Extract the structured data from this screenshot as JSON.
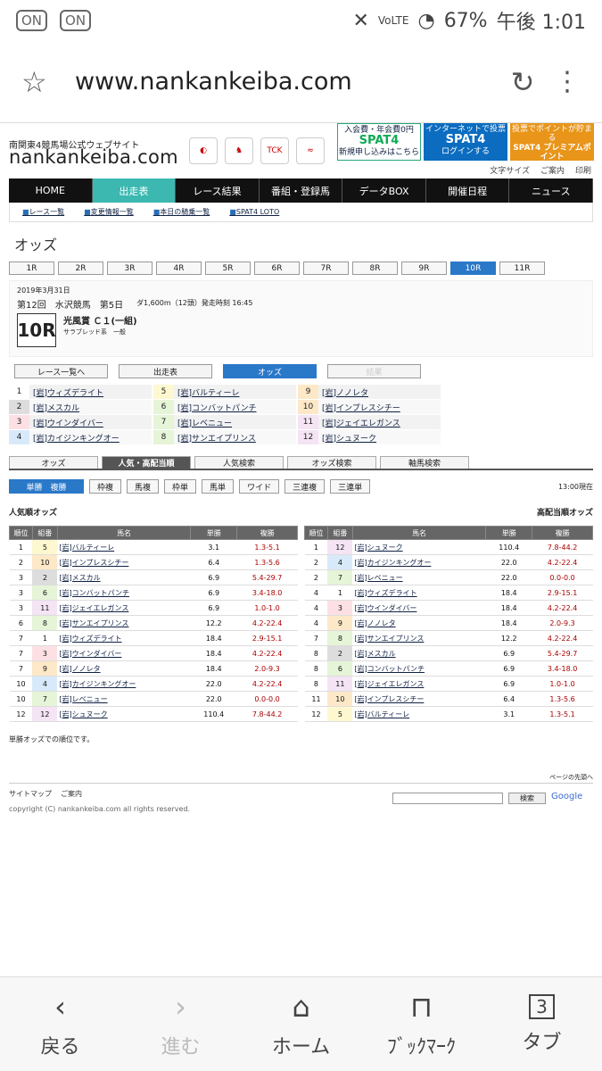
{
  "status": {
    "left_icons": [
      "ON",
      "ON"
    ],
    "volte": "VoLTE",
    "battery": "67%",
    "time": "午後 1:01"
  },
  "browser": {
    "url": "www.nankankeiba.com"
  },
  "site": {
    "subtitle": "南関東4競馬場公式ウェブサイト",
    "logo": "nankankeiba.com",
    "banners": [
      {
        "top": "入会費・年会費0円",
        "main": "SPAT4",
        "bottom": "新規申し込みはこちら"
      },
      {
        "top": "インターネットで投票",
        "main": "SPAT4",
        "bottom": "ログインする"
      },
      {
        "top": "投票でポイントが貯まる",
        "main": "SPAT4 プレミアムポイント",
        "bottom": "ログインする"
      }
    ],
    "tools": [
      "文字サイズ",
      "ご案内",
      "印刷"
    ],
    "nav": [
      "HOME",
      "出走表",
      "レース結果",
      "番組・登録馬",
      "データBOX",
      "開催日程",
      "ニュース"
    ],
    "subnav": [
      "レース一覧",
      "変更情報一覧",
      "本日の騎乗一覧",
      "SPAT4 LOTO"
    ]
  },
  "page_title": "オッズ",
  "races": [
    "1R",
    "2R",
    "3R",
    "4R",
    "5R",
    "6R",
    "7R",
    "8R",
    "9R",
    "10R",
    "11R"
  ],
  "race_info": {
    "date": "2019年3月31日",
    "meet": "第12回　水沢競馬　第5日",
    "distance": "ダ1,600m（12頭）発走時刻 16:45",
    "number": "10R",
    "name": "光風賞 Ｃ１(一組)",
    "class": "サラブレッド系　一般"
  },
  "race_buttons": [
    "レース一覧へ",
    "出走表",
    "オッズ",
    "結果"
  ],
  "entries": [
    {
      "n": "1",
      "name": "[岩]ウィズデライト",
      "c": "#fff"
    },
    {
      "n": "5",
      "name": "[岩]バルティーレ",
      "c": "#fdf8d0"
    },
    {
      "n": "9",
      "name": "[岩]ノノレタ",
      "c": "#fde8c8"
    },
    {
      "n": "2",
      "name": "[岩]メスカル",
      "c": "#ddd"
    },
    {
      "n": "6",
      "name": "[岩]コンバットパンチ",
      "c": "#e6f4d8"
    },
    {
      "n": "10",
      "name": "[岩]インプレスシチー",
      "c": "#fde8c8"
    },
    {
      "n": "3",
      "name": "[岩]ウインダイバー",
      "c": "#fde0e4"
    },
    {
      "n": "7",
      "name": "[岩]レベニュー",
      "c": "#e6f4d8"
    },
    {
      "n": "11",
      "name": "[岩]ジェイエレガンス",
      "c": "#f4e4f4"
    },
    {
      "n": "4",
      "name": "[岩]カイジンキングオー",
      "c": "#d8eafa"
    },
    {
      "n": "8",
      "name": "[岩]サンエイプリンス",
      "c": "#e6f4d8"
    },
    {
      "n": "12",
      "name": "[岩]シュヌーク",
      "c": "#f4e4f4"
    }
  ],
  "tabs": [
    "オッズ",
    "人気・高配当順",
    "人気検索",
    "オッズ検索",
    "軸馬検索"
  ],
  "bet_types": [
    "単勝　複勝",
    "枠複",
    "馬複",
    "枠単",
    "馬単",
    "ワイド",
    "三連複",
    "三連単"
  ],
  "time_now": "13:00現在",
  "pop_title": "人気順オッズ",
  "high_title": "高配当順オッズ",
  "headers": [
    "順位",
    "組番",
    "馬名",
    "単勝",
    "複勝"
  ],
  "pop_rows": [
    [
      "1",
      "5",
      "[岩]バルティーレ",
      "3.1",
      "1.3-5.1"
    ],
    [
      "2",
      "10",
      "[岩]インプレスシチー",
      "6.4",
      "1.3-5.6"
    ],
    [
      "3",
      "2",
      "[岩]メスカル",
      "6.9",
      "5.4-29.7"
    ],
    [
      "3",
      "6",
      "[岩]コンバットパンチ",
      "6.9",
      "3.4-18.0"
    ],
    [
      "3",
      "11",
      "[岩]ジェイエレガンス",
      "6.9",
      "1.0-1.0"
    ],
    [
      "6",
      "8",
      "[岩]サンエイプリンス",
      "12.2",
      "4.2-22.4"
    ],
    [
      "7",
      "1",
      "[岩]ウィズデライト",
      "18.4",
      "2.9-15.1"
    ],
    [
      "7",
      "3",
      "[岩]ウインダイバー",
      "18.4",
      "4.2-22.4"
    ],
    [
      "7",
      "9",
      "[岩]ノノレタ",
      "18.4",
      "2.0-9.3"
    ],
    [
      "10",
      "4",
      "[岩]カイジンキングオー",
      "22.0",
      "4.2-22.4"
    ],
    [
      "10",
      "7",
      "[岩]レベニュー",
      "22.0",
      "0.0-0.0"
    ],
    [
      "12",
      "12",
      "[岩]シュヌーク",
      "110.4",
      "7.8-44.2"
    ]
  ],
  "high_rows": [
    [
      "1",
      "12",
      "[岩]シュヌーク",
      "110.4",
      "7.8-44.2"
    ],
    [
      "2",
      "4",
      "[岩]カイジンキングオー",
      "22.0",
      "4.2-22.4"
    ],
    [
      "2",
      "7",
      "[岩]レベニュー",
      "22.0",
      "0.0-0.0"
    ],
    [
      "4",
      "1",
      "[岩]ウィズデライト",
      "18.4",
      "2.9-15.1"
    ],
    [
      "4",
      "3",
      "[岩]ウインダイバー",
      "18.4",
      "4.2-22.4"
    ],
    [
      "4",
      "9",
      "[岩]ノノレタ",
      "18.4",
      "2.0-9.3"
    ],
    [
      "7",
      "8",
      "[岩]サンエイプリンス",
      "12.2",
      "4.2-22.4"
    ],
    [
      "8",
      "2",
      "[岩]メスカル",
      "6.9",
      "5.4-29.7"
    ],
    [
      "8",
      "6",
      "[岩]コンバットパンチ",
      "6.9",
      "3.4-18.0"
    ],
    [
      "8",
      "11",
      "[岩]ジェイエレガンス",
      "6.9",
      "1.0-1.0"
    ],
    [
      "11",
      "10",
      "[岩]インプレスシチー",
      "6.4",
      "1.3-5.6"
    ],
    [
      "12",
      "5",
      "[岩]バルティーレ",
      "3.1",
      "1.3-5.1"
    ]
  ],
  "note": "単勝オッズでの順位です。",
  "page_top": "ページの先頭へ",
  "footer": {
    "links": [
      "サイトマップ",
      "ご案内"
    ],
    "copyright": "copyright (C) nankankeiba.com all rights reserved.",
    "search_btn": "検索",
    "google": "Google"
  },
  "bottom_nav": [
    {
      "icon": "‹",
      "label": "戻る"
    },
    {
      "icon": "›",
      "label": "進む"
    },
    {
      "icon": "⌂",
      "label": "ホーム"
    },
    {
      "icon": "⊓",
      "label": "ﾌﾞｯｸﾏｰｸ"
    },
    {
      "icon": "3",
      "label": "タブ"
    }
  ]
}
